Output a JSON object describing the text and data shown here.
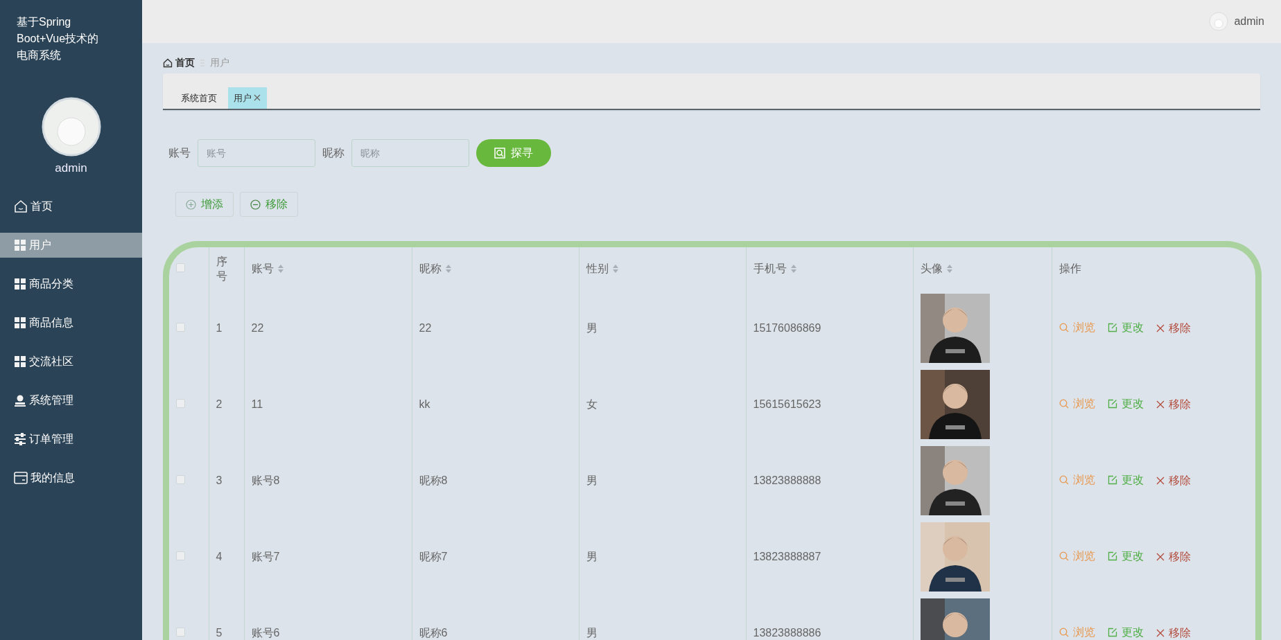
{
  "brand": {
    "title": "基于Spring Boot+Vue技术的电商系统"
  },
  "sidebar": {
    "username": "admin",
    "items": [
      {
        "label": "首页",
        "kind": "home",
        "selected": false
      },
      {
        "label": "用户",
        "kind": "grid",
        "selected": true
      },
      {
        "label": "商品分类",
        "kind": "grid",
        "selected": false
      },
      {
        "label": "商品信息",
        "kind": "grid",
        "selected": false
      },
      {
        "label": "交流社区",
        "kind": "grid",
        "selected": false
      },
      {
        "label": "系统管理",
        "kind": "person",
        "selected": false
      },
      {
        "label": "订单管理",
        "kind": "sliders",
        "selected": false
      },
      {
        "label": "我的信息",
        "kind": "card",
        "selected": false
      }
    ]
  },
  "topbar": {
    "username": "admin"
  },
  "breadcrumb": [
    {
      "label": "首页",
      "kind": "home"
    },
    {
      "label": "用户",
      "kind": "page"
    }
  ],
  "tabs": [
    {
      "label": "系统首页",
      "selected": false,
      "closable": false
    },
    {
      "label": "用户",
      "selected": true,
      "closable": true
    }
  ],
  "search": {
    "fields": [
      {
        "label": "账号",
        "placeholder": "账号"
      },
      {
        "label": "昵称",
        "placeholder": "昵称"
      }
    ],
    "button": "探寻"
  },
  "actions": [
    {
      "label": "增添",
      "kind": "add"
    },
    {
      "label": "移除",
      "kind": "remove"
    }
  ],
  "table": {
    "select_all": {
      "checked": false
    },
    "columns": [
      {
        "label": "序号",
        "sortable": false
      },
      {
        "label": "账号",
        "sortable": true
      },
      {
        "label": "昵称",
        "sortable": true
      },
      {
        "label": "性别",
        "sortable": true
      },
      {
        "label": "手机号",
        "sortable": true
      },
      {
        "label": "头像",
        "sortable": true
      },
      {
        "label": "操作",
        "sortable": false
      }
    ],
    "rows": [
      {
        "checked": false,
        "cells": [
          "1",
          "22",
          "22",
          "男",
          "15176086869"
        ],
        "actions": [
          {
            "label": "浏览",
            "kind": "view"
          },
          {
            "label": "更改",
            "kind": "edit"
          },
          {
            "label": "移除",
            "kind": "delete"
          }
        ]
      },
      {
        "checked": false,
        "cells": [
          "2",
          "11",
          "kk",
          "女",
          "15615615623"
        ],
        "actions": [
          {
            "label": "浏览",
            "kind": "view"
          },
          {
            "label": "更改",
            "kind": "edit"
          },
          {
            "label": "移除",
            "kind": "delete"
          }
        ]
      },
      {
        "checked": false,
        "cells": [
          "3",
          "账号8",
          "昵称8",
          "男",
          "13823888888"
        ],
        "actions": [
          {
            "label": "浏览",
            "kind": "view"
          },
          {
            "label": "更改",
            "kind": "edit"
          },
          {
            "label": "移除",
            "kind": "delete"
          }
        ]
      },
      {
        "checked": false,
        "cells": [
          "4",
          "账号7",
          "昵称7",
          "男",
          "13823888887"
        ],
        "actions": [
          {
            "label": "浏览",
            "kind": "view"
          },
          {
            "label": "更改",
            "kind": "edit"
          },
          {
            "label": "移除",
            "kind": "delete"
          }
        ]
      },
      {
        "checked": false,
        "cells": [
          "5",
          "账号6",
          "昵称6",
          "男",
          "13823888886"
        ],
        "actions": [
          {
            "label": "浏览",
            "kind": "view"
          },
          {
            "label": "更改",
            "kind": "edit"
          },
          {
            "label": "移除",
            "kind": "delete"
          }
        ]
      }
    ]
  }
}
